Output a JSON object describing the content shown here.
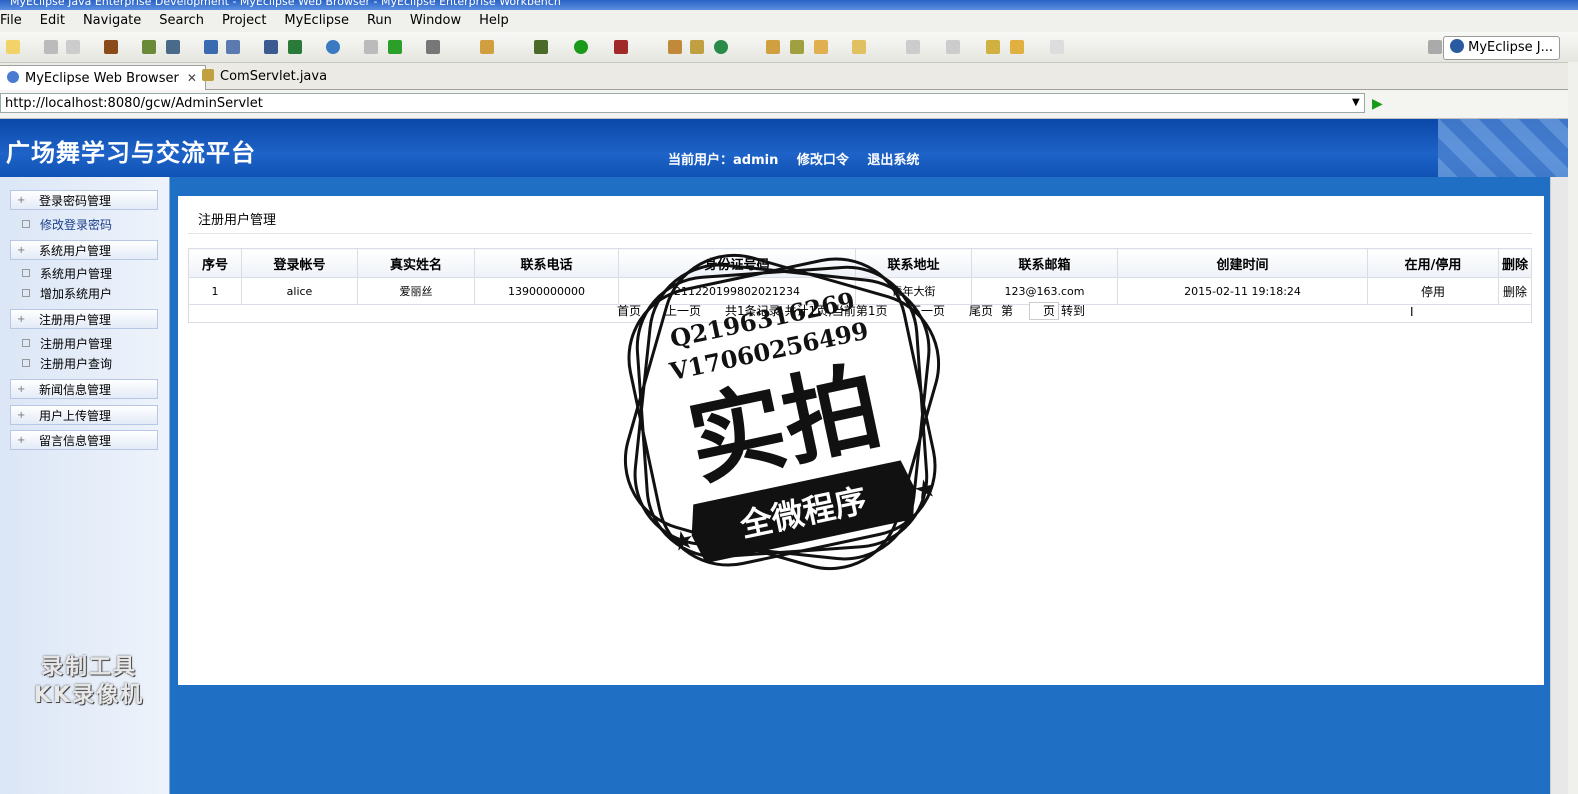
{
  "window": {
    "title": "MyEclipse Java Enterprise Development - MyEclipse Web Browser - MyEclipse Enterprise Workbench",
    "perspective": "MyEclipse J..."
  },
  "menu": [
    "File",
    "Edit",
    "Navigate",
    "Search",
    "Project",
    "MyEclipse",
    "Run",
    "Window",
    "Help"
  ],
  "tabs": [
    {
      "label": "MyEclipse Web Browser",
      "close": "✕"
    },
    {
      "label": "ComServlet.java"
    }
  ],
  "address": {
    "url": "http://localhost:8080/gcw/AdminServlet"
  },
  "header": {
    "site_title": "广场舞学习与交流平台",
    "current_user": "当前用户：admin",
    "change_password": "修改口令",
    "logout": "退出系统"
  },
  "sidebar": {
    "groups": [
      {
        "label": "登录密码管理",
        "items": [
          "修改登录密码"
        ]
      },
      {
        "label": "系统用户管理",
        "items": [
          "系统用户管理",
          "增加系统用户"
        ]
      },
      {
        "label": "注册用户管理",
        "items": [
          "注册用户管理",
          "注册用户查询"
        ]
      },
      {
        "label": "新闻信息管理",
        "items": []
      },
      {
        "label": "用户上传管理",
        "items": []
      },
      {
        "label": "留言信息管理",
        "items": []
      }
    ]
  },
  "panel": {
    "title": "注册用户管理",
    "columns": [
      "序号",
      "登录帐号",
      "真实姓名",
      "联系电话",
      "身份证号码",
      "联系地址",
      "联系邮箱",
      "创建时间",
      "在用/停用",
      "删除"
    ],
    "rows": [
      [
        "1",
        "alice",
        "爱丽丝",
        "13900000000",
        "211220199802021234",
        "青年大街",
        "123@163.com",
        "2015-02-11 19:18:24",
        "停用",
        "删除"
      ]
    ],
    "pager": {
      "first": "首页",
      "prev": "上一页",
      "summary": "共1条记录,共计1页,当前第1页",
      "next": "下一页",
      "last": "尾页",
      "page_prefix": "第",
      "page_suffix": "页",
      "goto": "转到"
    }
  },
  "stamp": {
    "qq": "Q2196316269",
    "wechat": "V17060256499",
    "big": "实拍",
    "banner": "全微程序"
  },
  "recorder_watermark": [
    "录制工具",
    "KK录像机"
  ]
}
